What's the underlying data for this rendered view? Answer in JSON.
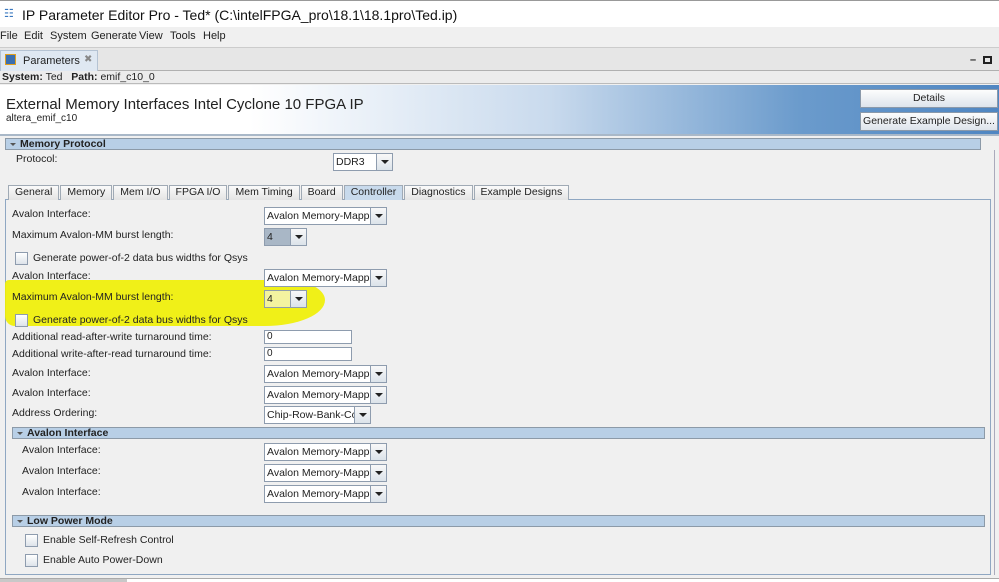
{
  "window": {
    "title": "IP Parameter Editor Pro - Ted* (C:\\intelFPGA_pro\\18.1\\18.1pro\\Ted.ip)"
  },
  "menu": [
    "File",
    "Edit",
    "System",
    "Generate",
    "View",
    "Tools",
    "Help"
  ],
  "panel_tab": "Parameters",
  "system_row": {
    "system_label": "System:",
    "system": "Ted",
    "path_label": "Path:",
    "path": "emif_c10_0"
  },
  "banner": {
    "title": "External Memory Interfaces Intel Cyclone 10 FPGA IP",
    "subtitle": "altera_emif_c10",
    "details": "Details",
    "generate": "Generate Example Design..."
  },
  "memory_protocol": {
    "header": "Memory Protocol",
    "protocol_label": "Protocol:",
    "protocol_value": "DDR3"
  },
  "tabs": [
    "General",
    "Memory",
    "Mem I/O",
    "FPGA I/O",
    "Mem Timing",
    "Board",
    "Controller",
    "Diagnostics",
    "Example Designs"
  ],
  "active_tab": "Controller",
  "controller": {
    "avalon1_label": "Avalon Interface:",
    "avalon1_value": "Avalon Memory-Mapped",
    "burst1_label": "Maximum Avalon-MM burst length:",
    "burst1_value": "4",
    "pow2_1": "Generate power-of-2 data bus widths for Qsys",
    "avalon2_label": "Avalon Interface:",
    "avalon2_value": "Avalon Memory-Mapped",
    "burst2_label": "Maximum Avalon-MM burst length:",
    "burst2_value": "4",
    "pow2_2": "Generate power-of-2 data bus widths for Qsys",
    "raw_label": "Additional read-after-write turnaround time:",
    "raw_value": "0",
    "war_label": "Additional write-after-read turnaround time:",
    "war_value": "0",
    "avalon3_label": "Avalon Interface:",
    "avalon3_value": "Avalon Memory-Mapped",
    "avalon4_label": "Avalon Interface:",
    "avalon4_value": "Avalon Memory-Mapped",
    "addr_label": "Address Ordering:",
    "addr_value": "Chip-Row-Bank-Col"
  },
  "avalon_section": {
    "header": "Avalon Interface",
    "rows": [
      {
        "label": "Avalon Interface:",
        "value": "Avalon Memory-Mapped"
      },
      {
        "label": "Avalon Interface:",
        "value": "Avalon Memory-Mapped"
      },
      {
        "label": "Avalon Interface:",
        "value": "Avalon Memory-Mapped"
      }
    ]
  },
  "low_power": {
    "header": "Low Power Mode",
    "self_refresh": "Enable Self-Refresh Control",
    "auto_pd": "Enable Auto Power-Down"
  },
  "colors": {
    "section": "#b8cfe6",
    "highlight": "#f0f000",
    "banner_blue": "#4f86c2"
  }
}
